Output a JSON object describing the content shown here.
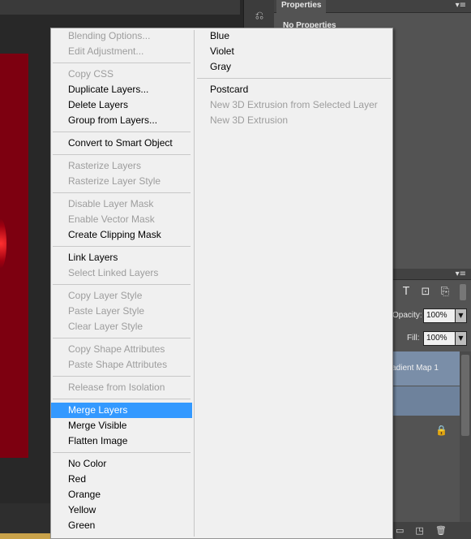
{
  "properties_panel": {
    "tab_label": "Properties",
    "content_text": "No Properties"
  },
  "layers_panel": {
    "opacity_label": "Opacity:",
    "opacity_value": "100%",
    "fill_label": "Fill:",
    "fill_value": "100%",
    "layer_name": "Gradient Map 1"
  },
  "context_menu": {
    "left_column": [
      {
        "label": "Blending Options...",
        "disabled": true
      },
      {
        "label": "Edit Adjustment...",
        "disabled": true
      },
      {
        "separator": true
      },
      {
        "label": "Copy CSS",
        "disabled": true
      },
      {
        "label": "Duplicate Layers...",
        "disabled": false
      },
      {
        "label": "Delete Layers",
        "disabled": false
      },
      {
        "label": "Group from Layers...",
        "disabled": false
      },
      {
        "separator": true
      },
      {
        "label": "Convert to Smart Object",
        "disabled": false
      },
      {
        "separator": true
      },
      {
        "label": "Rasterize Layers",
        "disabled": true
      },
      {
        "label": "Rasterize Layer Style",
        "disabled": true
      },
      {
        "separator": true
      },
      {
        "label": "Disable Layer Mask",
        "disabled": true
      },
      {
        "label": "Enable Vector Mask",
        "disabled": true
      },
      {
        "label": "Create Clipping Mask",
        "disabled": false
      },
      {
        "separator": true
      },
      {
        "label": "Link Layers",
        "disabled": false
      },
      {
        "label": "Select Linked Layers",
        "disabled": true
      },
      {
        "separator": true
      },
      {
        "label": "Copy Layer Style",
        "disabled": true
      },
      {
        "label": "Paste Layer Style",
        "disabled": true
      },
      {
        "label": "Clear Layer Style",
        "disabled": true
      },
      {
        "separator": true
      },
      {
        "label": "Copy Shape Attributes",
        "disabled": true
      },
      {
        "label": "Paste Shape Attributes",
        "disabled": true
      },
      {
        "separator": true
      },
      {
        "label": "Release from Isolation",
        "disabled": true
      },
      {
        "separator": true
      },
      {
        "label": "Merge Layers",
        "disabled": false,
        "highlighted": true
      },
      {
        "label": "Merge Visible",
        "disabled": false
      },
      {
        "label": "Flatten Image",
        "disabled": false
      },
      {
        "separator": true
      },
      {
        "label": "No Color",
        "disabled": false
      },
      {
        "label": "Red",
        "disabled": false
      },
      {
        "label": "Orange",
        "disabled": false
      },
      {
        "label": "Yellow",
        "disabled": false
      },
      {
        "label": "Green",
        "disabled": false
      }
    ],
    "right_column": [
      {
        "label": "Blue",
        "disabled": false
      },
      {
        "label": "Violet",
        "disabled": false
      },
      {
        "label": "Gray",
        "disabled": false
      },
      {
        "separator": true
      },
      {
        "label": "Postcard",
        "disabled": false
      },
      {
        "label": "New 3D Extrusion from Selected Layer",
        "disabled": true
      },
      {
        "label": "New 3D Extrusion",
        "disabled": true
      }
    ]
  },
  "colors": {
    "menu_background": "#f0f0f0",
    "highlight": "#3399ff",
    "disabled_text": "#9d9d9d",
    "canvas_red": "#7d0010",
    "panel_gray": "#535353"
  },
  "icons": {
    "history": "history-icon",
    "panel_menu": "panel-menu-icon",
    "type_filter": "type-filter-icon",
    "shape_filter": "shape-filter-icon",
    "smart_object_filter": "smart-object-filter-icon",
    "lock": "lock-icon",
    "new_group": "folder-icon",
    "new_layer": "new-layer-icon",
    "delete": "trash-icon"
  }
}
